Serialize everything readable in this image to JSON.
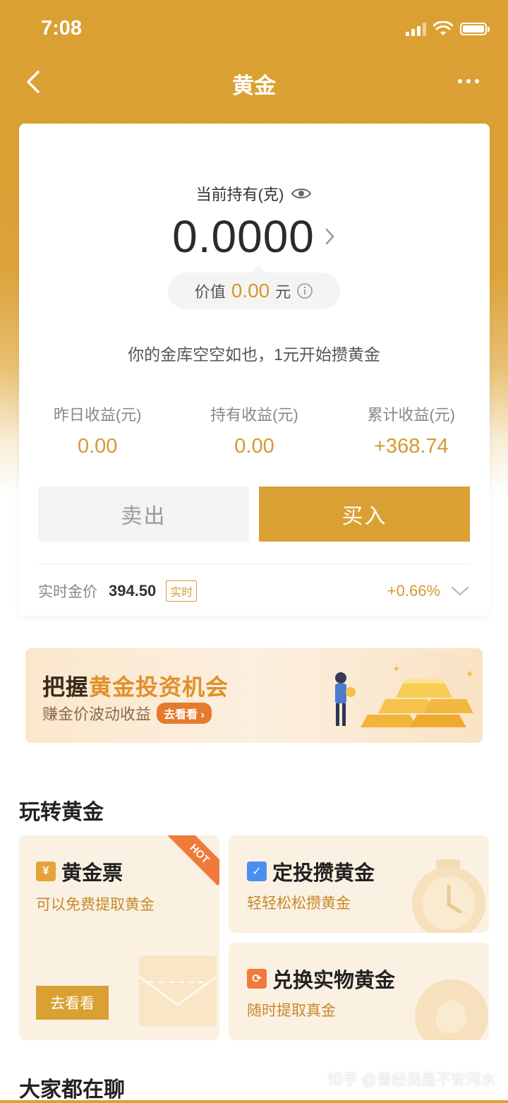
{
  "status_bar": {
    "time": "7:08"
  },
  "nav": {
    "title": "黄金"
  },
  "holdings": {
    "label": "当前持有(克)",
    "amount": "0.0000",
    "value_prefix": "价值",
    "value_amount": "0.00",
    "value_unit": "元",
    "empty_tip": "你的金库空空如也，1元开始攒黄金"
  },
  "stats": [
    {
      "label": "昨日收益(元)",
      "value": "0.00"
    },
    {
      "label": "持有收益(元)",
      "value": "0.00"
    },
    {
      "label": "累计收益(元)",
      "value": "+368.74"
    }
  ],
  "actions": {
    "sell": "卖出",
    "buy": "买入"
  },
  "price": {
    "label": "实时金价",
    "value": "394.50",
    "tag": "实时",
    "change": "+0.66%"
  },
  "banner": {
    "title_prefix": "把握",
    "title_highlight": "黄金投资机会",
    "subtitle": "赚金价波动收益",
    "button": "去看看"
  },
  "section_play": {
    "title": "玩转黄金"
  },
  "tiles": {
    "ticket": {
      "title": "黄金票",
      "subtitle": "可以免费提取黄金",
      "badge": "HOT",
      "button": "去看看",
      "icon_glyph": "¥"
    },
    "fixed": {
      "title": "定投攒黄金",
      "subtitle": "轻轻松松攒黄金"
    },
    "exchange": {
      "title": "兑换实物黄金",
      "subtitle": "随时提取真金"
    }
  },
  "section_chat": {
    "title": "大家都在聊"
  },
  "watermark": "知乎 @曾经我是不安河水",
  "colors": {
    "gold": "#dba033",
    "gold_text": "#d49a2f",
    "hot": "#ef7a3a"
  }
}
